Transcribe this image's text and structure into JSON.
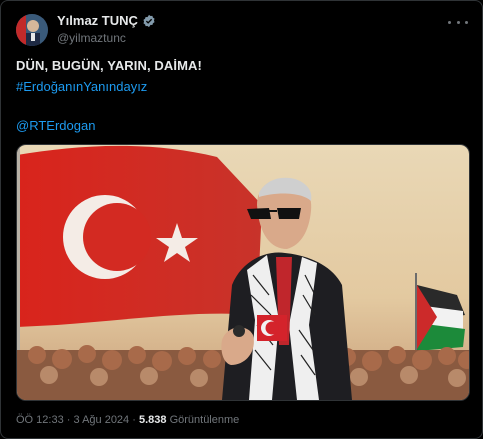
{
  "author": {
    "display_name": "Yılmaz TUNÇ",
    "handle": "@yilmaztunc"
  },
  "tweet": {
    "line1": "DÜN, BUGÜN, YARIN, DAİMA!",
    "hashtag": "#ErdoğanınYanındayız",
    "mention": "@RTErdogan"
  },
  "meta": {
    "time": "ÖÖ 12:33",
    "separator": "·",
    "date": "3 Ağu 2024",
    "views_count": "5.838",
    "views_label": "Görüntülenme"
  },
  "icons": {
    "verified": "verified-badge-icon",
    "more": "more-horizontal-icon"
  },
  "colors": {
    "background": "#000000",
    "text": "#e7e9ea",
    "muted": "#71767b",
    "link": "#1d9bf0",
    "border": "#2f3336",
    "flag_red": "#e30a17"
  }
}
